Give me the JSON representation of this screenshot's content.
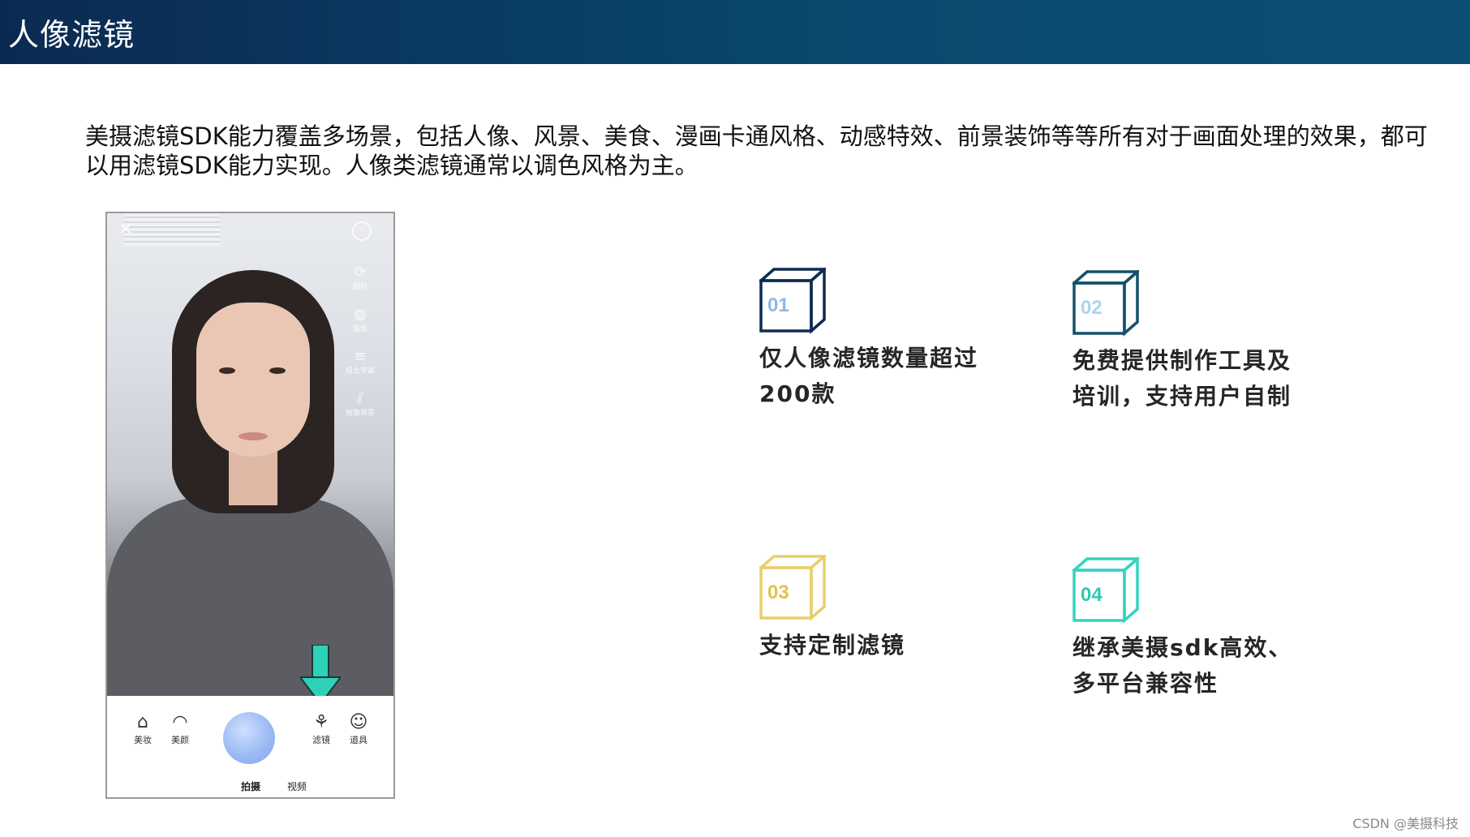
{
  "header": {
    "title": "人像滤镜"
  },
  "intro": "美摄滤镜SDK能力覆盖多场景，包括人像、风景、美食、漫画卡通风格、动感特效、前景装饰等等所有对于画面处理的效果，都可以用滤镜SDK能力实现。人像类滤镜通常以调色风格为主。",
  "phone": {
    "side_icons": [
      "翻转",
      "贴纸",
      "组合字幕",
      "抠像背景"
    ],
    "tools": [
      {
        "label": "美妆",
        "icon": "makeup-icon"
      },
      {
        "label": "美颜",
        "icon": "beauty-icon"
      },
      {
        "label": "滤镜",
        "icon": "filter-icon"
      },
      {
        "label": "道具",
        "icon": "props-icon"
      }
    ],
    "modes": [
      "拍摄",
      "视频"
    ],
    "arrow_color": "#2fd0b8"
  },
  "features": [
    {
      "num": "01",
      "text": "仅人像滤镜数量超过200款",
      "color": "#0d2a52",
      "num_color": "#8fb7e6"
    },
    {
      "num": "02",
      "text": "免费提供制作工具及培训，支持用户自制",
      "color": "#15506a",
      "num_color": "#a8d6ec"
    },
    {
      "num": "03",
      "text": "支持定制滤镜",
      "color": "#e9cf6a",
      "num_color": "#e2c24f"
    },
    {
      "num": "04",
      "text": "继承美摄sdk高效、多平台兼容性",
      "color": "#34d3c2",
      "num_color": "#2fc8b4"
    }
  ],
  "watermark": "CSDN @美摄科技"
}
